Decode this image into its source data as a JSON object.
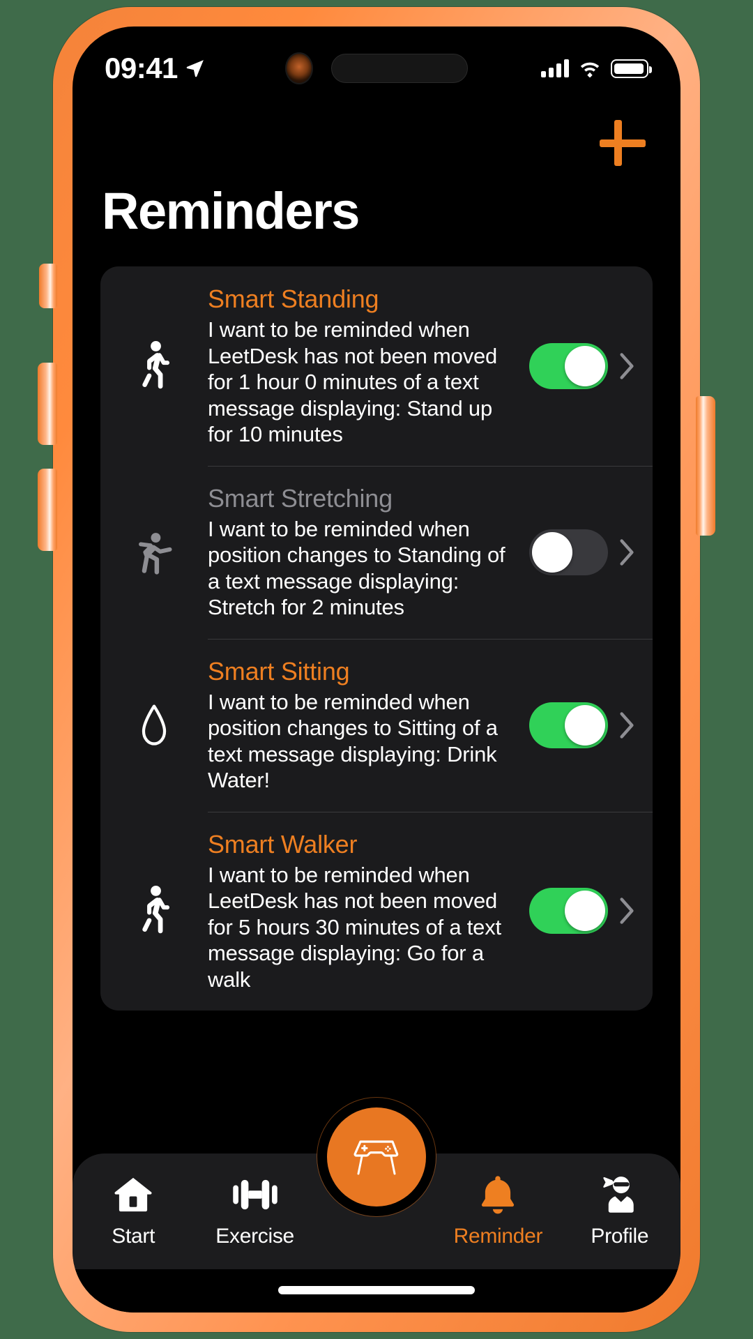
{
  "status_bar": {
    "time": "09:41",
    "location_icon": "location-arrow-icon",
    "camera_icon": "front-camera-icon",
    "dynamic_island": "dynamic-island",
    "signal_icon": "cellular-signal-icon",
    "wifi_icon": "wifi-icon",
    "battery_icon": "battery-full-icon"
  },
  "header": {
    "title": "Reminders",
    "add_button_icon": "plus-icon"
  },
  "colors": {
    "accent_orange": "#EE7F21",
    "toggle_on_green": "#30D158",
    "toggle_off_gray": "#39393D",
    "card_background": "#1B1B1D",
    "screen_background": "#000000",
    "dim_text": "#8E8E93",
    "frame_orange": "#F4833A"
  },
  "reminders": [
    {
      "icon": "walking-person-icon",
      "title": "Smart Standing",
      "description": "I want to be reminded when LeetDesk has not been moved for 1 hour 0 minutes of a text message displaying: Stand up for 10 minutes",
      "enabled": "on",
      "toggle_label": "Smart Standing toggle",
      "chevron_icon": "chevron-right-icon"
    },
    {
      "icon": "stretching-person-icon",
      "title": "Smart Stretching",
      "description": "I want to be reminded when position changes to Standing of a text message displaying: Stretch for 2 minutes",
      "enabled": "off",
      "toggle_label": "Smart Stretching toggle",
      "chevron_icon": "chevron-right-icon"
    },
    {
      "icon": "water-drop-icon",
      "title": "Smart Sitting",
      "description": "I want to be reminded when position changes to Sitting of a text message displaying: Drink Water!",
      "enabled": "on",
      "toggle_label": "Smart Sitting toggle",
      "chevron_icon": "chevron-right-icon"
    },
    {
      "icon": "walking-person-icon",
      "title": "Smart Walker",
      "description": "I want to be reminded when LeetDesk has not been moved for 5 hours 30 minutes of a text message displaying: Go for a walk",
      "enabled": "on",
      "toggle_label": "Smart Walker toggle",
      "chevron_icon": "chevron-right-icon"
    }
  ],
  "tabbar": {
    "items": [
      {
        "label": "Start",
        "icon": "home-icon",
        "active": "false"
      },
      {
        "label": "Exercise",
        "icon": "dumbbell-icon",
        "active": "false"
      },
      {
        "label": "",
        "icon": "desk-controller-icon",
        "active": "false"
      },
      {
        "label": "Reminder",
        "icon": "bell-icon",
        "active": "true"
      },
      {
        "label": "Profile",
        "icon": "ninja-person-icon",
        "active": "false"
      }
    ],
    "fab_icon": "desk-controller-icon",
    "home_indicator": "home-indicator"
  }
}
